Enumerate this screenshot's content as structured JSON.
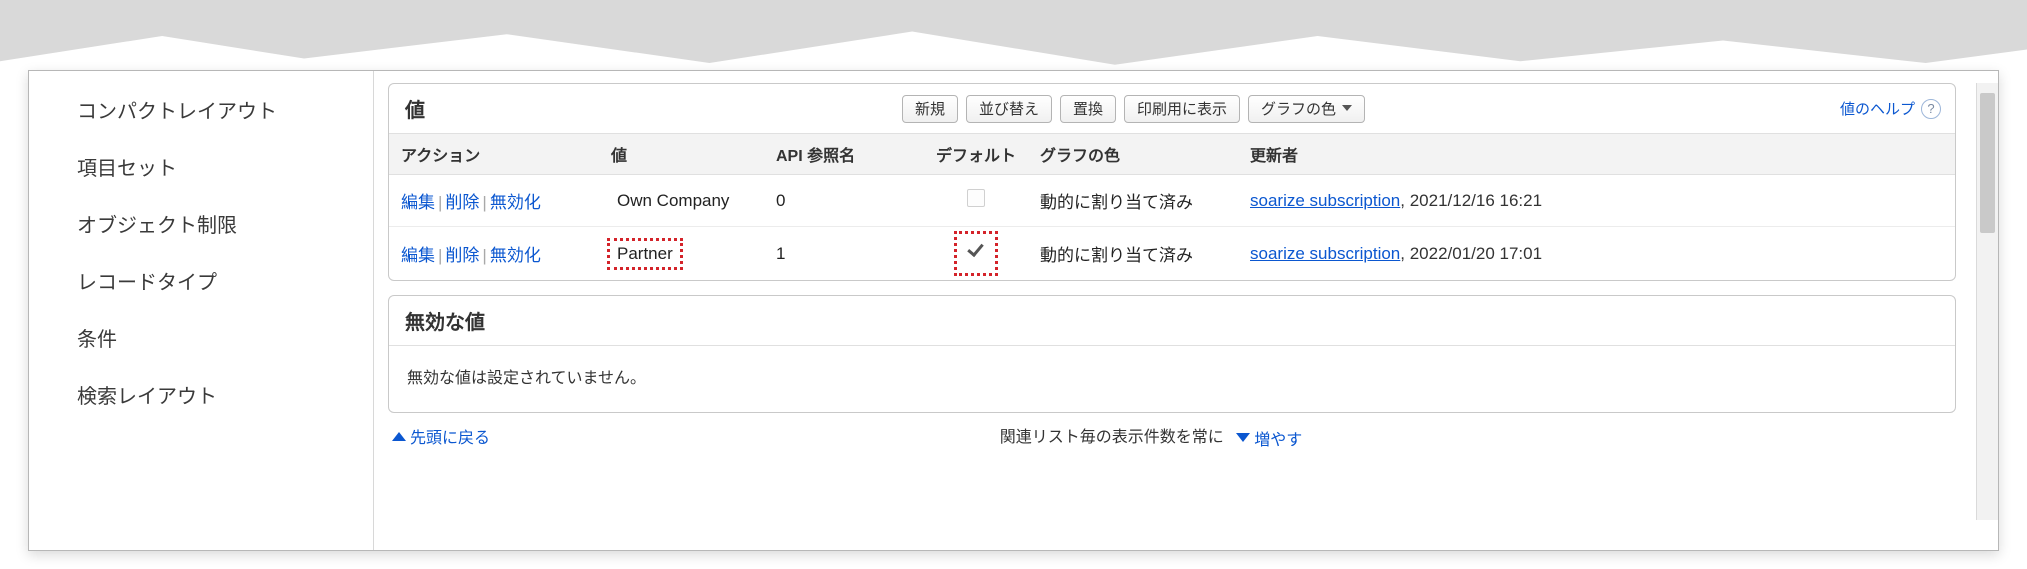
{
  "sidebar": {
    "items": [
      {
        "label": "コンパクトレイアウト"
      },
      {
        "label": "項目セット"
      },
      {
        "label": "オブジェクト制限"
      },
      {
        "label": "レコードタイプ"
      },
      {
        "label": "条件"
      },
      {
        "label": "検索レイアウト"
      }
    ]
  },
  "values_section": {
    "title": "値",
    "help_link": "値のヘルプ",
    "buttons": {
      "new": "新規",
      "reorder": "並び替え",
      "replace": "置換",
      "print": "印刷用に表示",
      "chart_color": "グラフの色"
    },
    "columns": {
      "action": "アクション",
      "value": "値",
      "api_name": "API 参照名",
      "default": "デフォルト",
      "chart_color": "グラフの色",
      "updated_by": "更新者"
    },
    "action_labels": {
      "edit": "編集",
      "delete": "削除",
      "deactivate": "無効化"
    },
    "rows": [
      {
        "value": "Own Company",
        "api_name": "0",
        "is_default": false,
        "chart_color": "動的に割り当て済み",
        "updated_user": "soarize subscription",
        "updated_at": ", 2021/12/16 16:21",
        "highlight_value": false,
        "highlight_default": false
      },
      {
        "value": "Partner",
        "api_name": "1",
        "is_default": true,
        "chart_color": "動的に割り当て済み",
        "updated_user": "soarize subscription",
        "updated_at": ", 2022/01/20 17:01",
        "highlight_value": true,
        "highlight_default": true
      }
    ]
  },
  "inactive_section": {
    "title": "無効な値",
    "empty_message": "無効な値は設定されていません。"
  },
  "footer": {
    "back_to_top": "先頭に戻る",
    "center_text": "関連リスト毎の表示件数を常に",
    "more": "増やす"
  }
}
